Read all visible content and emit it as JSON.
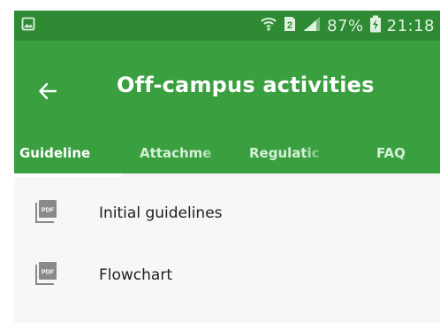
{
  "status_bar": {
    "battery_percent": "87%",
    "time": "21:18",
    "sim_badge": "2",
    "left_icon": "image-icon",
    "icons": [
      "wifi-icon",
      "sim-2-icon",
      "signal-icon",
      "battery-charging-icon"
    ]
  },
  "app_bar": {
    "title": "Off-campus activities",
    "back_icon": "arrow-left-icon"
  },
  "tabs": [
    {
      "label": "Guideline",
      "active": true
    },
    {
      "label": "Attachme",
      "active": false
    },
    {
      "label": "Regulatic",
      "active": false
    },
    {
      "label": "FAQ",
      "active": false
    }
  ],
  "list": {
    "items": [
      {
        "label": "Initial guidelines",
        "icon": "pdf-icon"
      },
      {
        "label": "Flowchart",
        "icon": "pdf-icon"
      }
    ]
  },
  "colors": {
    "status_bar": "#2e8b33",
    "app_bar": "#3aa03f",
    "background": "#f7f7f7",
    "text": "#202020",
    "tab_inactive": "#d7f0d8"
  }
}
